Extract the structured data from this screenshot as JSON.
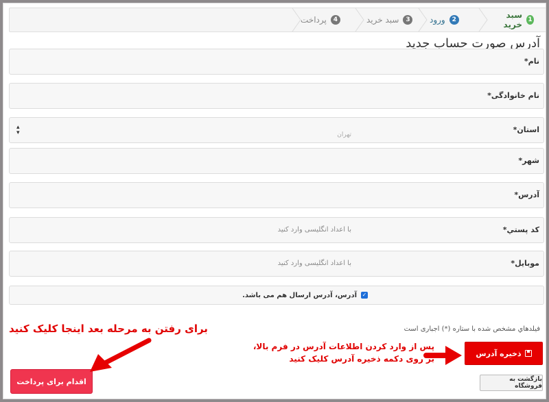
{
  "steps": [
    {
      "num": "1",
      "label": "سبد خرید"
    },
    {
      "num": "2",
      "label": "ورود"
    },
    {
      "num": "3",
      "label": "سبد خرید"
    },
    {
      "num": "4",
      "label": "پرداخت"
    }
  ],
  "page_title": "آدرس صورت حساب جدید",
  "form": {
    "first_name": {
      "label": "نام*",
      "value": ""
    },
    "last_name": {
      "label": "نام خانوادگی*",
      "value": ""
    },
    "province": {
      "label": "استان*",
      "value": "تهران"
    },
    "city": {
      "label": "شهر*",
      "value": ""
    },
    "address": {
      "label": "آدرس*",
      "value": ""
    },
    "postal_code": {
      "label": "کد پستي*",
      "placeholder": "با اعداد انگلیسی وارد کنید"
    },
    "mobile": {
      "label": "موبایل*",
      "placeholder": "با اعداد انگلیسی وارد کنید"
    },
    "same_shipping": {
      "label": "آدرس، آدرس ارسال هم می باشد.",
      "checked": true
    }
  },
  "required_note": "فیلدهاي مشخص شده با ستاره (*) اجباری است",
  "buttons": {
    "save": "ذخیره آدرس",
    "back_to_shop": "بازگشت به فروشگاه",
    "proceed_payment": "اقدام برای پرداخت"
  },
  "annotations": {
    "next_step": "برای رفتن به مرحله بعد اینجا کلیک کنید",
    "save_hint": "پس از وارد کردن اطلاعات آدرس در فرم بالا، بر روی دکمه ذخیره آدرس کلیک کنید"
  },
  "colors": {
    "accent_red": "#e60000",
    "pay_pink": "#f0354f",
    "step_green": "#5cb85c",
    "step_blue": "#337ab7"
  }
}
